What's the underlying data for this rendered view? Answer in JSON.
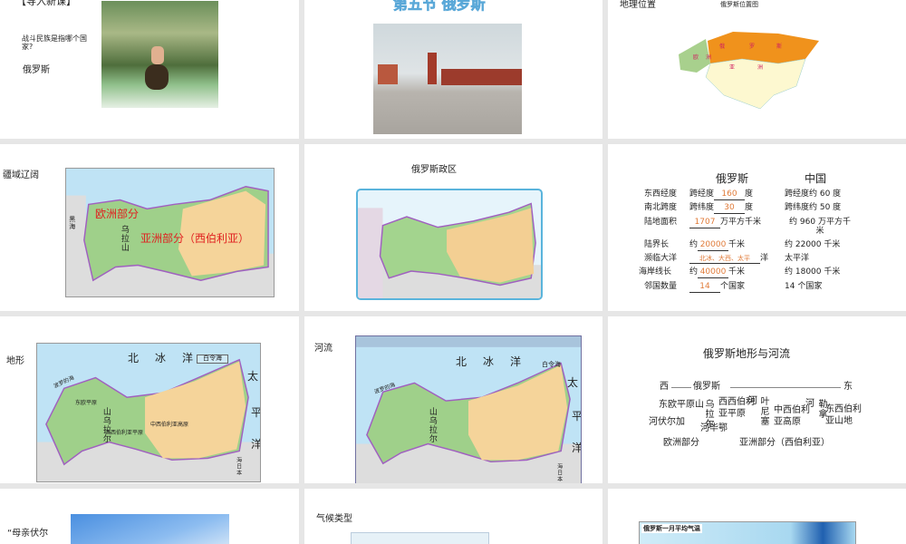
{
  "slides": [
    {
      "title": "【导入新课】",
      "question": "战斗民族是指哪个国家?",
      "answer": "俄罗斯"
    },
    {
      "title": "第五节  俄罗斯"
    },
    {
      "title": "地理位置",
      "map_title": "俄罗斯位置图",
      "map_labels": [
        "俄",
        "罗",
        "斯",
        "欧",
        "洲",
        "亚",
        "洲"
      ]
    },
    {
      "title": "疆域辽阔",
      "labels": {
        "europe": "欧洲部分",
        "asia": "亚洲部分（西伯利亚）",
        "ural": "乌拉山",
        "black_sea": "黑海"
      }
    },
    {
      "title": "俄罗斯政区"
    },
    {
      "headers": [
        "俄罗斯",
        "中国"
      ],
      "rows": [
        {
          "label": "东西经度",
          "ru_pre": "跨经度",
          "ru_ans": "160",
          "ru_post": "度",
          "cn": "跨经度约 60 度"
        },
        {
          "label": "南北跨度",
          "ru_pre": "跨纬度",
          "ru_ans": "30",
          "ru_post": "度",
          "cn": "跨纬度约 50 度"
        },
        {
          "label": "陆地面积",
          "ru_pre": "",
          "ru_ans": "1707",
          "ru_post": "万平方千米",
          "cn": "约 960 万平方千米"
        },
        {
          "label": "陆界长",
          "ru_pre": "约",
          "ru_ans": "20000",
          "ru_post": "千米",
          "cn": "约 22000 千米"
        },
        {
          "label": "濒临大洋",
          "ru_pre": "",
          "ru_ans": "北冰、大西、太平",
          "ru_post": "洋",
          "cn": "太平洋"
        },
        {
          "label": "海岸线长",
          "ru_pre": "约",
          "ru_ans": "40000",
          "ru_post": "千米",
          "cn": "约 18000 千米"
        },
        {
          "label": "邻国数量",
          "ru_pre": "",
          "ru_ans": "14",
          "ru_post": "个国家",
          "cn": "14 个国家"
        }
      ]
    },
    {
      "title": "地形",
      "labels": {
        "ocean1": "北",
        "ocean2": "冰",
        "ocean3": "洋",
        "white_sea": "白令海",
        "pac1": "太",
        "pac2": "平",
        "pac3": "洋",
        "baltic": "波罗的海",
        "plain": "东欧平原",
        "ural": "山乌拉尔",
        "wsib": "西西伯利亚平原",
        "csib": "中西伯利亚高原",
        "japan": "海日本"
      }
    },
    {
      "title": "河流",
      "labels": {
        "ocean1": "北",
        "ocean2": "冰",
        "ocean3": "洋",
        "white_sea": "白令海",
        "pac1": "太",
        "pac2": "平",
        "pac3": "洋",
        "baltic": "波罗的海",
        "ural": "山乌拉尔",
        "japan": "海日本"
      }
    },
    {
      "title": "俄罗斯地形与河流",
      "west": "西",
      "russia": "俄罗斯",
      "east": "东",
      "items": {
        "east_europe_plain": "东欧平原",
        "ural_shan": "山",
        "ural": "乌拉尔",
        "wsib": "西西伯利亚平原",
        "he1": "河",
        "yenisei": "叶尼塞",
        "csib": "中西伯利亚高原",
        "he2": "河",
        "lena": "勒拿",
        "esib": "东西伯利亚山地",
        "volga": "河伏尔加",
        "ob": "河毕鄂",
        "europe": "欧洲部分",
        "asia": "亚洲部分（西伯利亚）"
      }
    },
    {
      "title": "“母亲伏尔"
    },
    {
      "title": "气候类型"
    },
    {
      "map_title": "俄罗斯一月平均气温"
    }
  ]
}
